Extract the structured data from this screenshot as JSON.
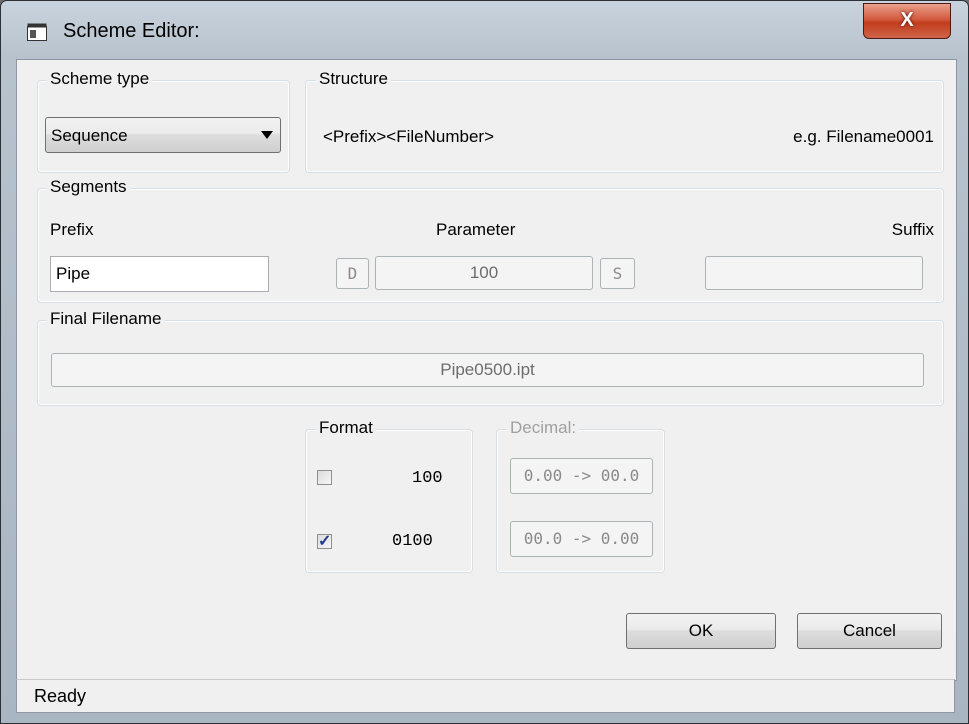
{
  "window": {
    "title": "Scheme Editor:",
    "close_glyph": "X"
  },
  "scheme_type": {
    "group_title": "Scheme type",
    "selected": "Sequence"
  },
  "structure": {
    "group_title": "Structure",
    "pattern": "<Prefix><FileNumber>",
    "example": "e.g. Filename0001"
  },
  "segments": {
    "group_title": "Segments",
    "prefix_label": "Prefix",
    "parameter_label": "Parameter",
    "suffix_label": "Suffix",
    "prefix_value": "Pipe",
    "decrement_label": "D",
    "parameter_value": "100",
    "increment_label": "S",
    "suffix_value": ""
  },
  "final_filename": {
    "group_title": "Final Filename",
    "value": "Pipe0500.ipt"
  },
  "format": {
    "group_title": "Format",
    "options": [
      {
        "label": "100",
        "checked": false
      },
      {
        "label": "0100",
        "checked": true
      }
    ]
  },
  "decimal": {
    "group_title": "Decimal:",
    "button1": "0.00 -> 00.0",
    "button2": "00.0 -> 0.00"
  },
  "buttons": {
    "ok": "OK",
    "cancel": "Cancel"
  },
  "status": {
    "text": "Ready"
  }
}
